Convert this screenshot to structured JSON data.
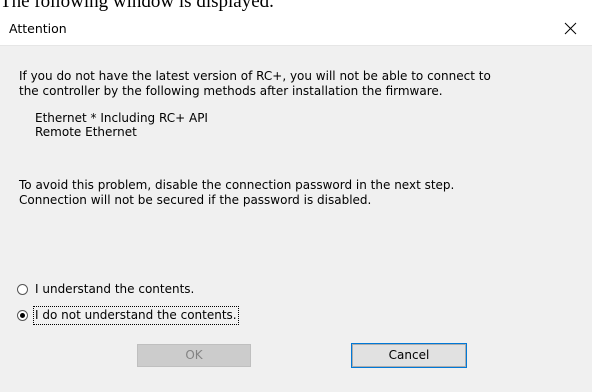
{
  "caption": "The following window is displayed.",
  "dialog": {
    "title": "Attention",
    "close_icon": "close-icon",
    "message": {
      "line1": "If you do not have the latest version of RC+, you will not be able to connect to",
      "line2": "the controller by the following methods after installation the firmware.",
      "method1": "Ethernet  * Including RC+ API",
      "method2": "Remote Ethernet",
      "line3": "To avoid this problem, disable the connection password in the next step.",
      "line4": "Connection will not be secured if the password is disabled."
    },
    "options": [
      {
        "label": "I understand the contents.",
        "selected": false
      },
      {
        "label": "I do not understand the contents.",
        "selected": true
      }
    ],
    "ok_label": "OK",
    "ok_enabled": false,
    "cancel_label": "Cancel"
  }
}
